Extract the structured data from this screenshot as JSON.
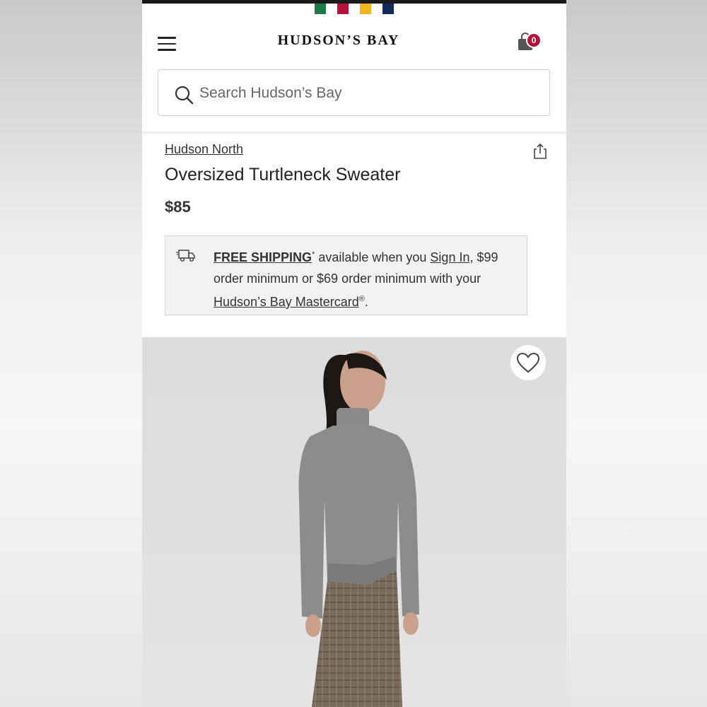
{
  "header": {
    "brand": "HUDSON’S BAY",
    "bag_count": "0",
    "stripe_colors": [
      "#1d7a46",
      "#b5123a",
      "#f2b51d",
      "#13295b"
    ]
  },
  "search": {
    "placeholder": "Search Hudson’s Bay"
  },
  "product": {
    "brand": "Hudson North",
    "title": "Oversized Turtleneck Sweater",
    "price": "$85"
  },
  "shipping": {
    "free_shipping": "FREE SHIPPING",
    "asterisk": "*",
    "text1": " available when you ",
    "sign_in": "Sign In",
    "text2": ", $99 order minimum or $69 order minimum with your ",
    "mastercard": "Hudson’s Bay Mastercard",
    "registered": "®",
    "end": "."
  },
  "icons": {
    "menu": "hamburger-menu-icon",
    "bag": "shopping-bag-icon",
    "search": "search-icon",
    "share": "share-icon",
    "truck": "delivery-truck-icon",
    "favorite": "heart-icon"
  }
}
